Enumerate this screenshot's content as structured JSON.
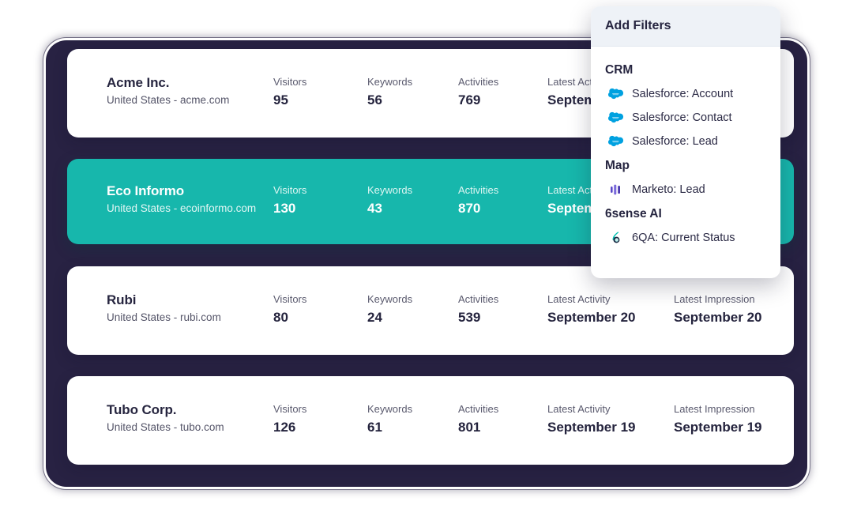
{
  "theme": {
    "backdrop": "#282243",
    "card_bg": "#ffffff",
    "highlight_teal": "#17b7ac",
    "text_dark": "#26253f",
    "text_muted": "#5a5a6e",
    "salesforce_blue": "#00a1e0",
    "marketo_purple": "#5c4ac7",
    "sixqa_teal": "#00c2b2"
  },
  "columns": [
    "Visitors",
    "Keywords",
    "Activities",
    "Latest Activity",
    "Latest Impression"
  ],
  "accounts": [
    {
      "name": "Acme Inc.",
      "sub": "United States - acme.com",
      "highlighted": false,
      "visitors": "95",
      "keywords": "56",
      "activities": "769",
      "latest_activity": "September",
      "latest_impression": ""
    },
    {
      "name": "Eco Informo",
      "sub": "United States - ecoinformo.com",
      "highlighted": true,
      "visitors": "130",
      "keywords": "43",
      "activities": "870",
      "latest_activity": "September",
      "latest_impression": ""
    },
    {
      "name": "Rubi",
      "sub": "United States - rubi.com",
      "highlighted": false,
      "visitors": "80",
      "keywords": "24",
      "activities": "539",
      "latest_activity": "September 20",
      "latest_impression": "September 20"
    },
    {
      "name": "Tubo Corp.",
      "sub": "United States - tubo.com",
      "highlighted": false,
      "visitors": "126",
      "keywords": "61",
      "activities": "801",
      "latest_activity": "September 19",
      "latest_impression": "September 19"
    }
  ],
  "filters_panel": {
    "title": "Add Filters",
    "groups": [
      {
        "title": "CRM",
        "items": [
          {
            "label": "Salesforce: Account",
            "icon": "salesforce-cloud-icon"
          },
          {
            "label": "Salesforce: Contact",
            "icon": "salesforce-cloud-icon"
          },
          {
            "label": "Salesforce: Lead",
            "icon": "salesforce-cloud-icon"
          }
        ]
      },
      {
        "title": "Map",
        "items": [
          {
            "label": "Marketo: Lead",
            "icon": "marketo-bars-icon"
          }
        ]
      },
      {
        "title": "6sense AI",
        "items": [
          {
            "label": "6QA: Current Status",
            "icon": "sixqa-flame-icon"
          }
        ]
      }
    ]
  }
}
